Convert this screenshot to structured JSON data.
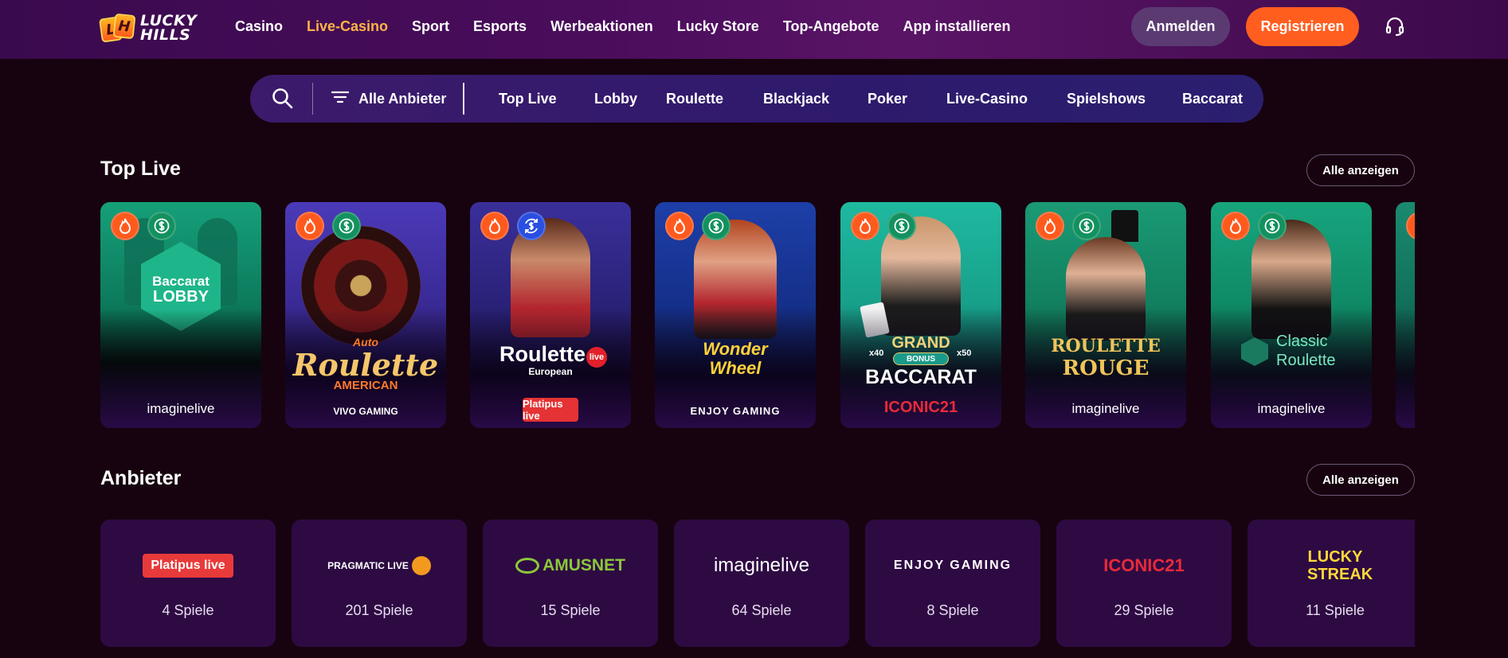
{
  "brand": {
    "logo_line1": "LUCKY",
    "logo_line2": "HILLS",
    "logo_tile1": "L",
    "logo_tile2": "H"
  },
  "nav": {
    "items": [
      {
        "label": "Casino",
        "active": false
      },
      {
        "label": "Live-Casino",
        "active": true
      },
      {
        "label": "Sport",
        "active": false
      },
      {
        "label": "Esports",
        "active": false
      },
      {
        "label": "Werbeaktionen",
        "active": false
      },
      {
        "label": "Lucky Store",
        "active": false
      },
      {
        "label": "Top-Angebote",
        "active": false
      },
      {
        "label": "App installieren",
        "active": false
      }
    ],
    "login": "Anmelden",
    "register": "Registrieren",
    "support_icon": "headset-icon"
  },
  "filter_bar": {
    "search_icon": "search-icon",
    "provider_filter": "Alle Anbieter",
    "tabs": [
      "Top Live",
      "Lobby",
      "Roulette",
      "Blackjack",
      "Poker",
      "Live-Casino",
      "Spielshows",
      "Baccarat"
    ]
  },
  "top_live": {
    "title": "Top Live",
    "show_all": "Alle anzeigen",
    "games": [
      {
        "badges": [
          "fire-icon",
          "dollar-icon"
        ],
        "title_line1": "Baccarat",
        "title_line2": "LOBBY",
        "provider": "imaginelive"
      },
      {
        "badges": [
          "fire-icon",
          "dollar-icon"
        ],
        "title_line1": "Auto",
        "title_line2": "Roulette",
        "title_line3": "AMERICAN",
        "provider": "VIVO GAMING"
      },
      {
        "badges": [
          "fire-icon",
          "sync-dollar-icon"
        ],
        "title_line1": "Roulette",
        "title_line2": "European",
        "title_tag": "live",
        "provider": "Platipus live"
      },
      {
        "badges": [
          "fire-icon",
          "dollar-icon"
        ],
        "title_line1": "Wonder",
        "title_line2": "Wheel",
        "provider": "ENJOY GAMING"
      },
      {
        "badges": [
          "fire-icon",
          "dollar-icon"
        ],
        "title_line1": "GRAND",
        "title_line2": "BONUS",
        "title_line3": "BACCARAT",
        "multiplier_left": "x40",
        "multiplier_right": "x50",
        "provider": "ICONIC21"
      },
      {
        "badges": [
          "fire-icon",
          "dollar-icon"
        ],
        "title_line1": "ROULETTE",
        "title_line2": "ROUGE",
        "provider": "imaginelive"
      },
      {
        "badges": [
          "fire-icon",
          "dollar-icon"
        ],
        "title_line1": "Classic",
        "title_line2": "Roulette",
        "provider": "imaginelive"
      }
    ]
  },
  "providers": {
    "title": "Anbieter",
    "show_all": "Alle anzeigen",
    "items": [
      {
        "name": "Platipus live",
        "count": "4 Spiele"
      },
      {
        "name": "PRAGMATIC LIVE",
        "count": "201 Spiele"
      },
      {
        "name": "AMUSNET",
        "count": "15 Spiele"
      },
      {
        "name": "imaginelive",
        "count": "64 Spiele"
      },
      {
        "name": "ENJOY GAMING",
        "count": "8 Spiele"
      },
      {
        "name": "ICONIC21",
        "count": "29 Spiele"
      },
      {
        "name": "LUCKY STREAK",
        "count": "11 Spiele"
      }
    ]
  },
  "colors": {
    "background": "#17030f",
    "header": "#4a0d5c",
    "accent_orange": "#ff5e1f",
    "active_nav": "#ffb347",
    "provider_card": "#2e0a43"
  }
}
